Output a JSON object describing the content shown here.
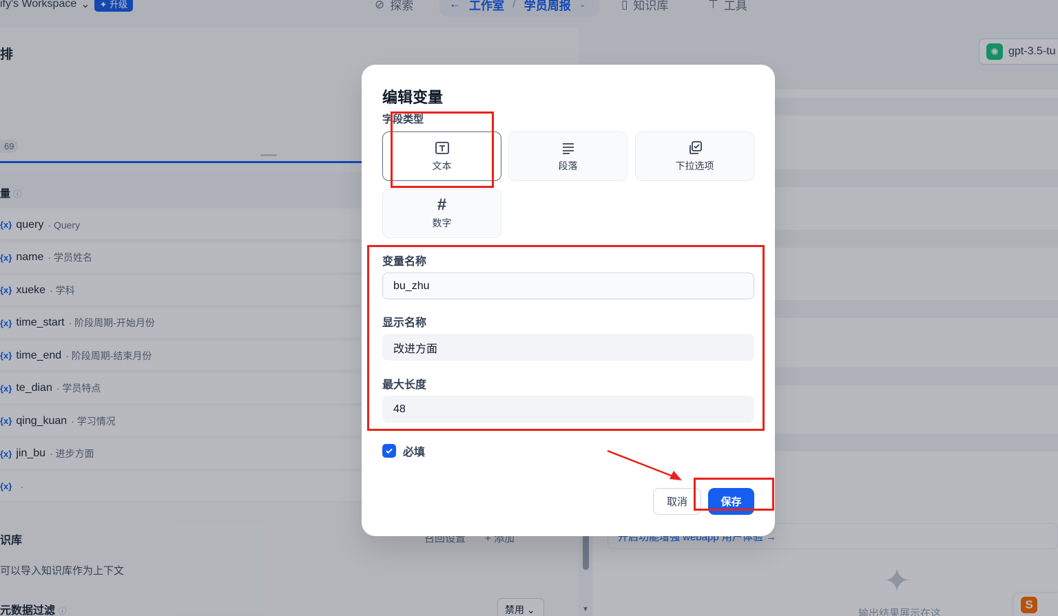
{
  "topbar": {
    "workspace": "ify's Workspace",
    "upgrade": "✦ 升级",
    "explore": "探索",
    "studio": "工作室",
    "separator": "/",
    "app_name": "学员周报",
    "knowledge": "知识库",
    "tools": "工具"
  },
  "left": {
    "page_title": "排",
    "badge": "69",
    "variables_header": "量",
    "variables": [
      {
        "key": "query",
        "label": "· Query"
      },
      {
        "key": "name",
        "label": "· 学员姓名"
      },
      {
        "key": "xueke",
        "label": "· 学科"
      },
      {
        "key": "time_start",
        "label": "· 阶段周期-开始月份"
      },
      {
        "key": "time_end",
        "label": "· 阶段周期-结束月份"
      },
      {
        "key": "te_dian",
        "label": "· 学员特点"
      },
      {
        "key": "qing_kuan",
        "label": "· 学习情况"
      },
      {
        "key": "jin_bu",
        "label": "· 进步方面"
      },
      {
        "key": "",
        "label": "·"
      }
    ],
    "var_icon": "{x}",
    "knowledge_title": "识库",
    "knowledge_desc": "可以导入知识库作为上下文",
    "recall_settings": "召回设置",
    "add": "+ 添加",
    "metadata_filter": "元数据过滤",
    "disabled": "禁用"
  },
  "right": {
    "model": "gpt-3.5-tu",
    "webapp_hint": "开启功能增强 webapp 用户体验 →",
    "output_hint": "输出结果展示在这"
  },
  "modal": {
    "title": "编辑变量",
    "field_type_label": "字段类型",
    "types": [
      {
        "label": "文本",
        "icon": "text-icon"
      },
      {
        "label": "段落",
        "icon": "paragraph-icon"
      },
      {
        "label": "下拉选项",
        "icon": "select-icon"
      },
      {
        "label": "数字",
        "icon": "number-icon"
      }
    ],
    "selected_type": "文本",
    "variable_name_label": "变量名称",
    "variable_name_value": "bu_zhu",
    "display_name_label": "显示名称",
    "display_name_value": "改进方面",
    "max_length_label": "最大长度",
    "max_length_value": "48",
    "required_label": "必填",
    "required_checked": true,
    "cancel": "取消",
    "save": "保存"
  },
  "colors": {
    "primary": "#155eef",
    "annotation": "#e8221b"
  }
}
